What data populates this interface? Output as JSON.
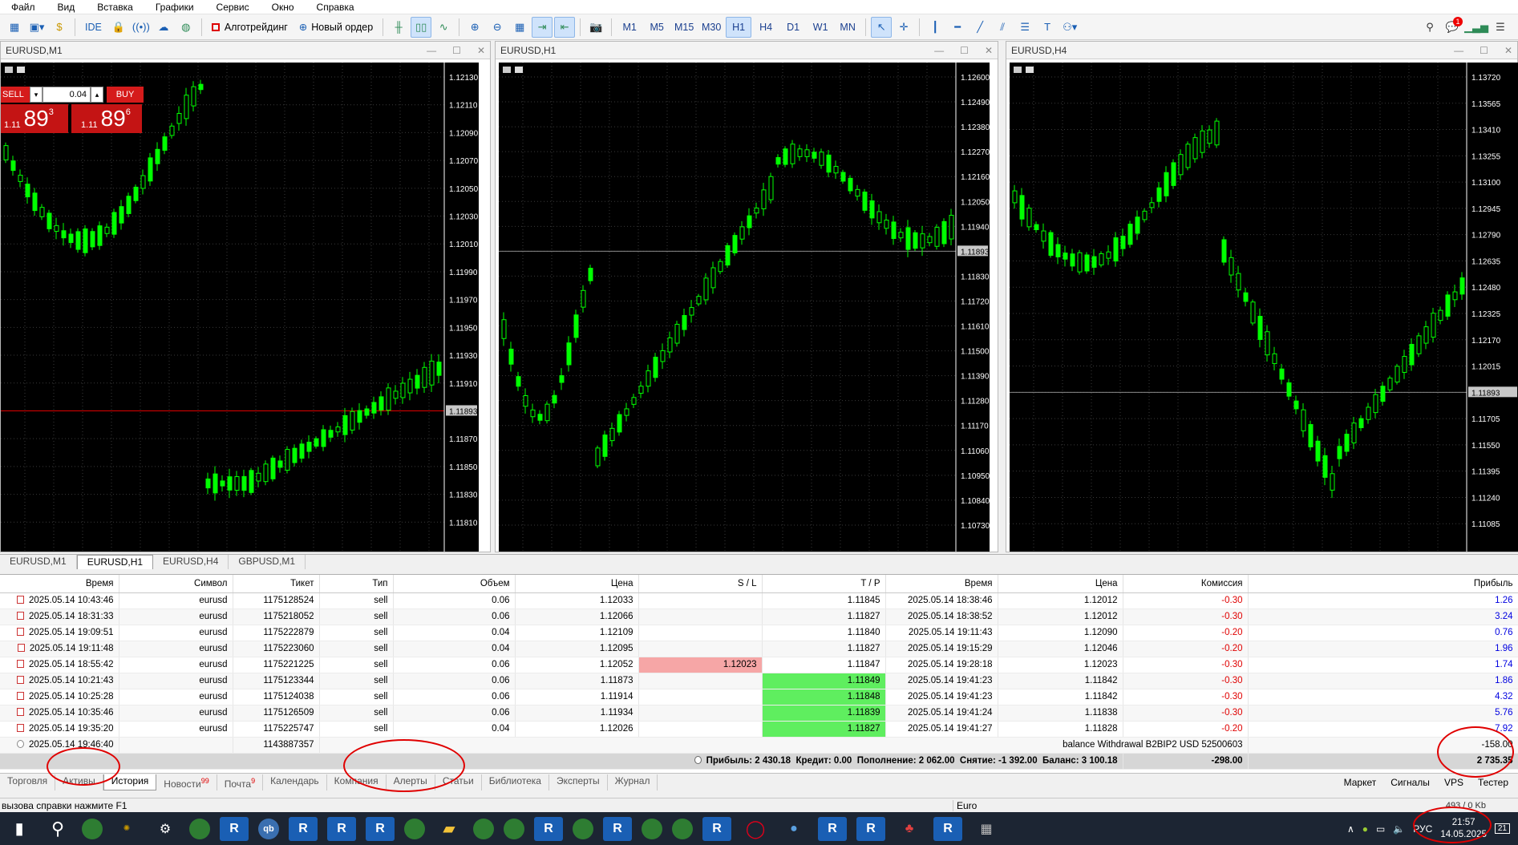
{
  "menu": [
    "Файл",
    "Вид",
    "Вставка",
    "Графики",
    "Сервис",
    "Окно",
    "Справка"
  ],
  "toolbar": {
    "ide": "IDE",
    "algotrading": "Алготрейдинг",
    "new_order": "Новый ордер",
    "timeframes": [
      "M1",
      "M5",
      "M15",
      "M30",
      "H1",
      "H4",
      "D1",
      "W1",
      "MN"
    ],
    "active_timeframe": "H1",
    "notif_count": "1"
  },
  "charts": [
    {
      "title": "EURUSD,M1",
      "price_labels": [
        "1.12130",
        "1.12110",
        "1.12090",
        "1.12070",
        "1.12050",
        "1.12030",
        "1.12010",
        "1.11990",
        "1.11970",
        "1.11950",
        "1.11930",
        "1.11910",
        "1.11893",
        "1.11870",
        "1.11850",
        "1.11830",
        "1.11810"
      ],
      "current_price": "1.11893",
      "one_click": {
        "sell_label": "SELL",
        "buy_label": "BUY",
        "volume": "0.04",
        "sell_big": "89",
        "sell_sup": "3",
        "buy_big": "89",
        "buy_sup": "6",
        "prefix": "1.11"
      }
    },
    {
      "title": "EURUSD,H1",
      "price_labels": [
        "1.12600",
        "1.12490",
        "1.12380",
        "1.12270",
        "1.12160",
        "1.12050",
        "1.11940",
        "1.11893",
        "1.11830",
        "1.11720",
        "1.11610",
        "1.11500",
        "1.11390",
        "1.11280",
        "1.11170",
        "1.11060",
        "1.10950",
        "1.10840",
        "1.10730"
      ],
      "current_price": "1.11893"
    },
    {
      "title": "EURUSD,H4",
      "price_labels": [
        "1.13720",
        "1.13565",
        "1.13410",
        "1.13255",
        "1.13100",
        "1.12945",
        "1.12790",
        "1.12635",
        "1.12480",
        "1.12325",
        "1.12170",
        "1.12015",
        "1.11893",
        "1.11705",
        "1.11550",
        "1.11395",
        "1.11240",
        "1.11085"
      ],
      "current_price": "1.11893"
    }
  ],
  "chart_tabs": [
    "EURUSD,M1",
    "EURUSD,H1",
    "EURUSD,H4",
    "GBPUSD,M1"
  ],
  "active_chart_tab": "EURUSD,H1",
  "history": {
    "columns": [
      "Время",
      "Символ",
      "Тикет",
      "Тип",
      "Объем",
      "Цена",
      "S / L",
      "T / P",
      "Время",
      "Цена",
      "Комиссия",
      "Прибыль"
    ],
    "rows": [
      {
        "open_time": "2025.05.14 10:43:46",
        "symbol": "eurusd",
        "ticket": "1175128524",
        "type": "sell",
        "volume": "0.06",
        "price": "1.12033",
        "sl": "",
        "tp": "1.11845",
        "close_time": "2025.05.14 18:38:46",
        "close_price": "1.12012",
        "commission": "-0.30",
        "profit": "1.26",
        "sl_hit": false,
        "tp_hit": false
      },
      {
        "open_time": "2025.05.14 18:31:33",
        "symbol": "eurusd",
        "ticket": "1175218052",
        "type": "sell",
        "volume": "0.06",
        "price": "1.12066",
        "sl": "",
        "tp": "1.11827",
        "close_time": "2025.05.14 18:38:52",
        "close_price": "1.12012",
        "commission": "-0.30",
        "profit": "3.24",
        "sl_hit": false,
        "tp_hit": false
      },
      {
        "open_time": "2025.05.14 19:09:51",
        "symbol": "eurusd",
        "ticket": "1175222879",
        "type": "sell",
        "volume": "0.04",
        "price": "1.12109",
        "sl": "",
        "tp": "1.11840",
        "close_time": "2025.05.14 19:11:43",
        "close_price": "1.12090",
        "commission": "-0.20",
        "profit": "0.76",
        "sl_hit": false,
        "tp_hit": false
      },
      {
        "open_time": "2025.05.14 19:11:48",
        "symbol": "eurusd",
        "ticket": "1175223060",
        "type": "sell",
        "volume": "0.04",
        "price": "1.12095",
        "sl": "",
        "tp": "1.11827",
        "close_time": "2025.05.14 19:15:29",
        "close_price": "1.12046",
        "commission": "-0.20",
        "profit": "1.96",
        "sl_hit": false,
        "tp_hit": false
      },
      {
        "open_time": "2025.05.14 18:55:42",
        "symbol": "eurusd",
        "ticket": "1175221225",
        "type": "sell",
        "volume": "0.06",
        "price": "1.12052",
        "sl": "1.12023",
        "tp": "1.11847",
        "close_time": "2025.05.14 19:28:18",
        "close_price": "1.12023",
        "commission": "-0.30",
        "profit": "1.74",
        "sl_hit": true,
        "tp_hit": false
      },
      {
        "open_time": "2025.05.14 10:21:43",
        "symbol": "eurusd",
        "ticket": "1175123344",
        "type": "sell",
        "volume": "0.06",
        "price": "1.11873",
        "sl": "",
        "tp": "1.11849",
        "close_time": "2025.05.14 19:41:23",
        "close_price": "1.11842",
        "commission": "-0.30",
        "profit": "1.86",
        "sl_hit": false,
        "tp_hit": true
      },
      {
        "open_time": "2025.05.14 10:25:28",
        "symbol": "eurusd",
        "ticket": "1175124038",
        "type": "sell",
        "volume": "0.06",
        "price": "1.11914",
        "sl": "",
        "tp": "1.11848",
        "close_time": "2025.05.14 19:41:23",
        "close_price": "1.11842",
        "commission": "-0.30",
        "profit": "4.32",
        "sl_hit": false,
        "tp_hit": true
      },
      {
        "open_time": "2025.05.14 10:35:46",
        "symbol": "eurusd",
        "ticket": "1175126509",
        "type": "sell",
        "volume": "0.06",
        "price": "1.11934",
        "sl": "",
        "tp": "1.11839",
        "close_time": "2025.05.14 19:41:24",
        "close_price": "1.11838",
        "commission": "-0.30",
        "profit": "5.76",
        "sl_hit": false,
        "tp_hit": true
      },
      {
        "open_time": "2025.05.14 19:35:20",
        "symbol": "eurusd",
        "ticket": "1175225747",
        "type": "sell",
        "volume": "0.04",
        "price": "1.12026",
        "sl": "",
        "tp": "1.11827",
        "close_time": "2025.05.14 19:41:27",
        "close_price": "1.11828",
        "commission": "-0.20",
        "profit": "7.92",
        "sl_hit": false,
        "tp_hit": true
      }
    ],
    "balance_row": {
      "time": "2025.05.14 19:46:40",
      "ticket": "1143887357",
      "text": "balance  Withdrawal B2BIP2 USD 52500603",
      "profit": "-158.00"
    },
    "summary": {
      "profit": "Прибыль: 2 430.18",
      "credit": "Кредит: 0.00",
      "deposit": "Пополнение: 2 062.00",
      "withdrawal": "Снятие: -1 392.00",
      "balance": "Баланс: 3 100.18",
      "commission_total": "-298.00",
      "profit_total": "2 735.35"
    }
  },
  "bottom_tabs": [
    {
      "label": "Торговля"
    },
    {
      "label": "Активы"
    },
    {
      "label": "История",
      "active": true
    },
    {
      "label": "Новости",
      "badge": "99"
    },
    {
      "label": "Почта",
      "badge": "9"
    },
    {
      "label": "Календарь"
    },
    {
      "label": "Компания"
    },
    {
      "label": "Алерты"
    },
    {
      "label": "Статьи"
    },
    {
      "label": "Библиотека"
    },
    {
      "label": "Эксперты"
    },
    {
      "label": "Журнал"
    }
  ],
  "bottom_right": [
    "Маркет",
    "Сигналы",
    "VPS",
    "Тестер"
  ],
  "status": {
    "help": "вызова справки нажмите F1",
    "profile": "Euro",
    "traffic": "493 / 0 Kb"
  },
  "taskbar": {
    "lang": "РУС",
    "time": "21:57",
    "date": "14.05.2025",
    "notif": "21"
  }
}
